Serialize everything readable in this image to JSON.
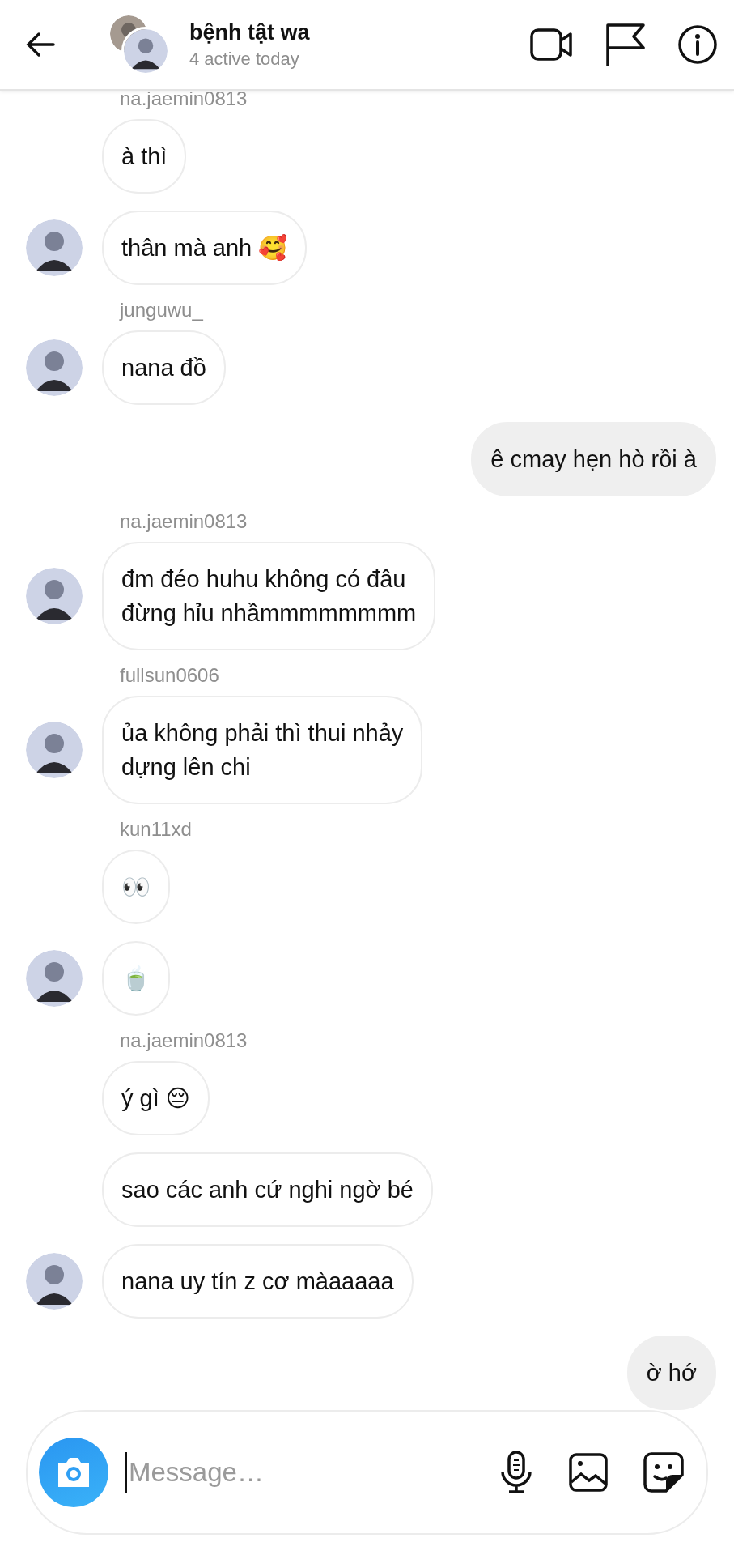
{
  "header": {
    "title": "bệnh tật wa",
    "subtitle": "4 active today"
  },
  "messages": [
    {
      "kind": "sender",
      "text": "na.jaemin0813"
    },
    {
      "kind": "incoming",
      "text": "à thì",
      "avatar": false
    },
    {
      "kind": "incoming",
      "text": "thân mà anh 🥰",
      "avatar": true
    },
    {
      "kind": "sender",
      "text": "junguwu_"
    },
    {
      "kind": "incoming",
      "text": "nana đồ",
      "avatar": true
    },
    {
      "kind": "outgoing",
      "text": "ê cmay hẹn hò rồi à"
    },
    {
      "kind": "sender",
      "text": "na.jaemin0813"
    },
    {
      "kind": "incoming",
      "text": "đm đéo huhu không có đâu\nđừng hỉu nhầmmmmmmmm",
      "avatar": true
    },
    {
      "kind": "sender",
      "text": "fullsun0606"
    },
    {
      "kind": "incoming",
      "text": "ủa không phải thì thui nhảy\ndựng lên chi",
      "avatar": true
    },
    {
      "kind": "sender",
      "text": "kun11xd"
    },
    {
      "kind": "incoming",
      "text": "👀",
      "avatar": false
    },
    {
      "kind": "incoming",
      "text": "🍵",
      "avatar": true
    },
    {
      "kind": "sender",
      "text": "na.jaemin0813"
    },
    {
      "kind": "incoming",
      "text": "ý gì 😔",
      "avatar": false
    },
    {
      "kind": "incoming",
      "text": "sao các anh cứ nghi ngờ bé",
      "avatar": false
    },
    {
      "kind": "incoming",
      "text": "nana uy tín z cơ màaaaaa",
      "avatar": true
    },
    {
      "kind": "outgoing",
      "text": "ờ hớ"
    }
  ],
  "composer": {
    "placeholder": "Message…"
  }
}
